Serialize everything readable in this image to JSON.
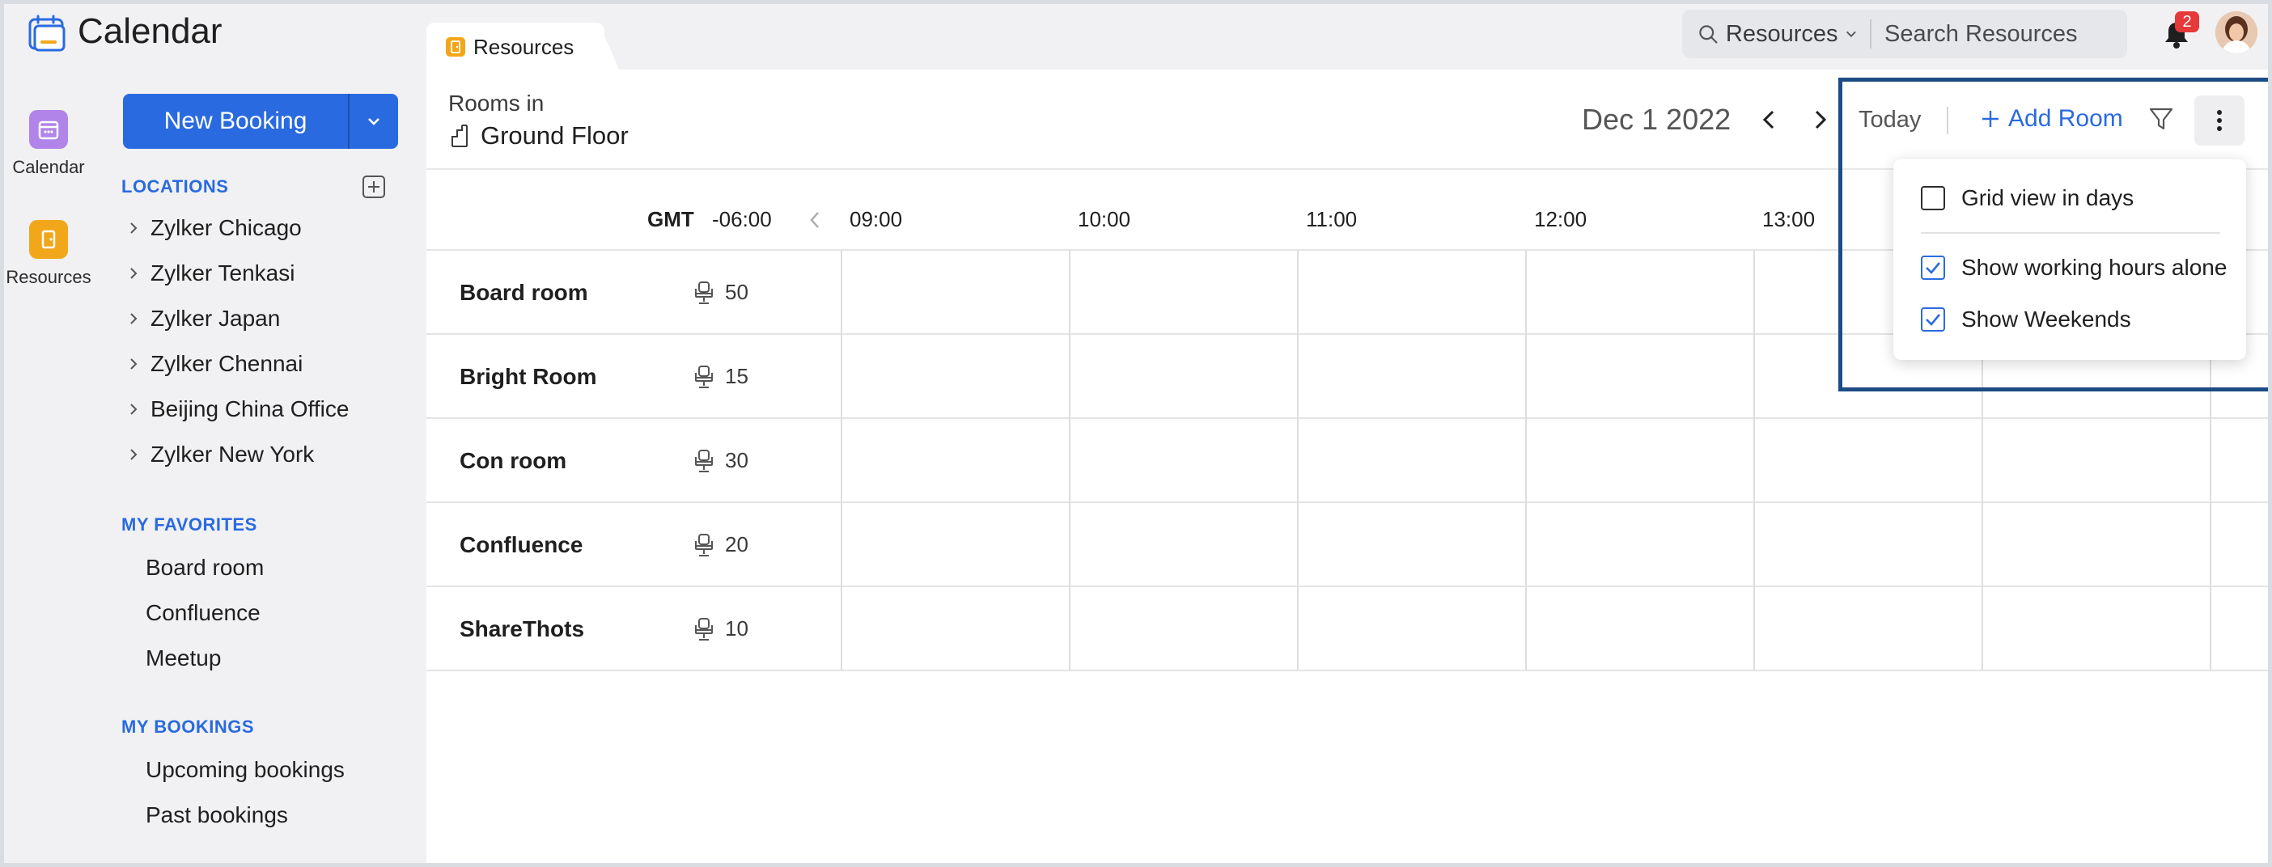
{
  "app": {
    "title": "Calendar"
  },
  "search": {
    "scope": "Resources",
    "placeholder": "Search Resources"
  },
  "notifications": {
    "count": "2"
  },
  "rail": {
    "calendar_label": "Calendar",
    "resources_label": "Resources"
  },
  "sidebar": {
    "new_booking_label": "New Booking",
    "locations_header": "LOCATIONS",
    "locations": [
      "Zylker Chicago",
      "Zylker Tenkasi",
      "Zylker Japan",
      "Zylker Chennai",
      "Beijing China Office",
      "Zylker New York"
    ],
    "favorites_header": "MY FAVORITES",
    "favorites": [
      "Board room",
      "Confluence",
      "Meetup"
    ],
    "bookings_header": "MY BOOKINGS",
    "bookings": [
      "Upcoming bookings",
      "Past bookings"
    ]
  },
  "tab": {
    "label": "Resources"
  },
  "header": {
    "rooms_in": "Rooms in",
    "floor": "Ground Floor",
    "date": "Dec 1 2022",
    "today_label": "Today",
    "add_room_label": "Add Room"
  },
  "grid": {
    "timezone_label": "GMT",
    "timezone_offset": "-06:00",
    "hours": [
      "09:00",
      "10:00",
      "11:00",
      "12:00",
      "13:00"
    ],
    "rooms": [
      {
        "name": "Board room",
        "capacity": "50"
      },
      {
        "name": "Bright Room",
        "capacity": "15"
      },
      {
        "name": "Con room",
        "capacity": "30"
      },
      {
        "name": "Confluence",
        "capacity": "20"
      },
      {
        "name": "ShareThots",
        "capacity": "10"
      }
    ]
  },
  "menu": {
    "items": [
      {
        "label": "Grid view in days",
        "checked": false
      },
      {
        "label": "Show working hours alone",
        "checked": true
      },
      {
        "label": "Show Weekends",
        "checked": true
      }
    ]
  },
  "colors": {
    "accent": "#2a6ae0",
    "calendar_rail": "#b084e8",
    "resources_rail": "#f2a71b",
    "highlight": "#1d4c85",
    "badge": "#e63a3a"
  }
}
